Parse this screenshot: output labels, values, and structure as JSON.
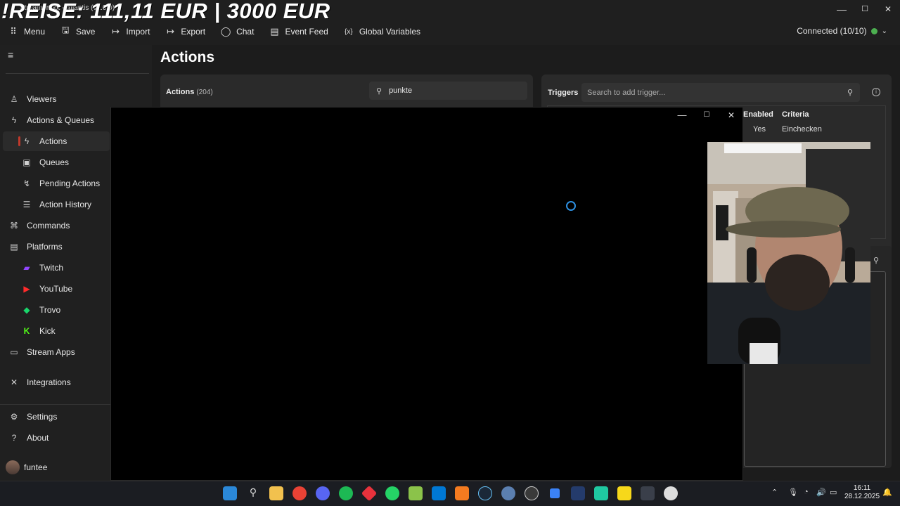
{
  "overlay": {
    "headline": "!REISE: 111,11 EUR | 3000 EUR"
  },
  "window": {
    "title": "Streamer.bot - Atlantis (v1.0.0)",
    "minimize": "—",
    "maximize": "☐",
    "close": "✕"
  },
  "menu": {
    "items": [
      {
        "label": "Menu",
        "icon": "grid-icon"
      },
      {
        "label": "Save",
        "icon": "save-icon"
      },
      {
        "label": "Import",
        "icon": "import-icon"
      },
      {
        "label": "Export",
        "icon": "export-icon"
      },
      {
        "label": "Chat",
        "icon": "chat-icon"
      },
      {
        "label": "Event Feed",
        "icon": "feed-icon"
      },
      {
        "label": "Global Variables",
        "icon": "variables-icon"
      }
    ],
    "connection_status": "Connected (10/10)",
    "connection_color": "#4caf50"
  },
  "sidebar": {
    "items": [
      {
        "label": "Viewers",
        "icon": "person-icon"
      },
      {
        "label": "Actions & Queues",
        "icon": "bolt-icon"
      },
      {
        "label": "Actions",
        "icon": "bolt-icon"
      },
      {
        "label": "Queues",
        "icon": "queue-icon"
      },
      {
        "label": "Pending Actions",
        "icon": "pending-icon"
      },
      {
        "label": "Action History",
        "icon": "history-icon"
      },
      {
        "label": "Commands",
        "icon": "command-icon"
      },
      {
        "label": "Platforms",
        "icon": "platforms-icon"
      },
      {
        "label": "Twitch",
        "icon": "twitch-icon"
      },
      {
        "label": "YouTube",
        "icon": "youtube-icon"
      },
      {
        "label": "Trovo",
        "icon": "trovo-icon"
      },
      {
        "label": "Kick",
        "icon": "kick-icon"
      },
      {
        "label": "Stream Apps",
        "icon": "stream-apps-icon"
      },
      {
        "label": "Integrations",
        "icon": "integrations-icon"
      },
      {
        "label": "Settings",
        "icon": "gear-icon"
      },
      {
        "label": "About",
        "icon": "help-icon"
      }
    ],
    "user": "funtee"
  },
  "page": {
    "title": "Actions"
  },
  "actions": {
    "label": "Actions",
    "count": "(204)",
    "search_value": "punkte"
  },
  "triggers": {
    "label": "Triggers",
    "search_placeholder": "Search to add trigger...",
    "columns": [
      "Enabled",
      "Criteria"
    ],
    "row": {
      "enabled": "Yes",
      "criteria": "Einchecken"
    }
  },
  "taskbar": {
    "time": "16:11",
    "date": "28.12.2025"
  }
}
